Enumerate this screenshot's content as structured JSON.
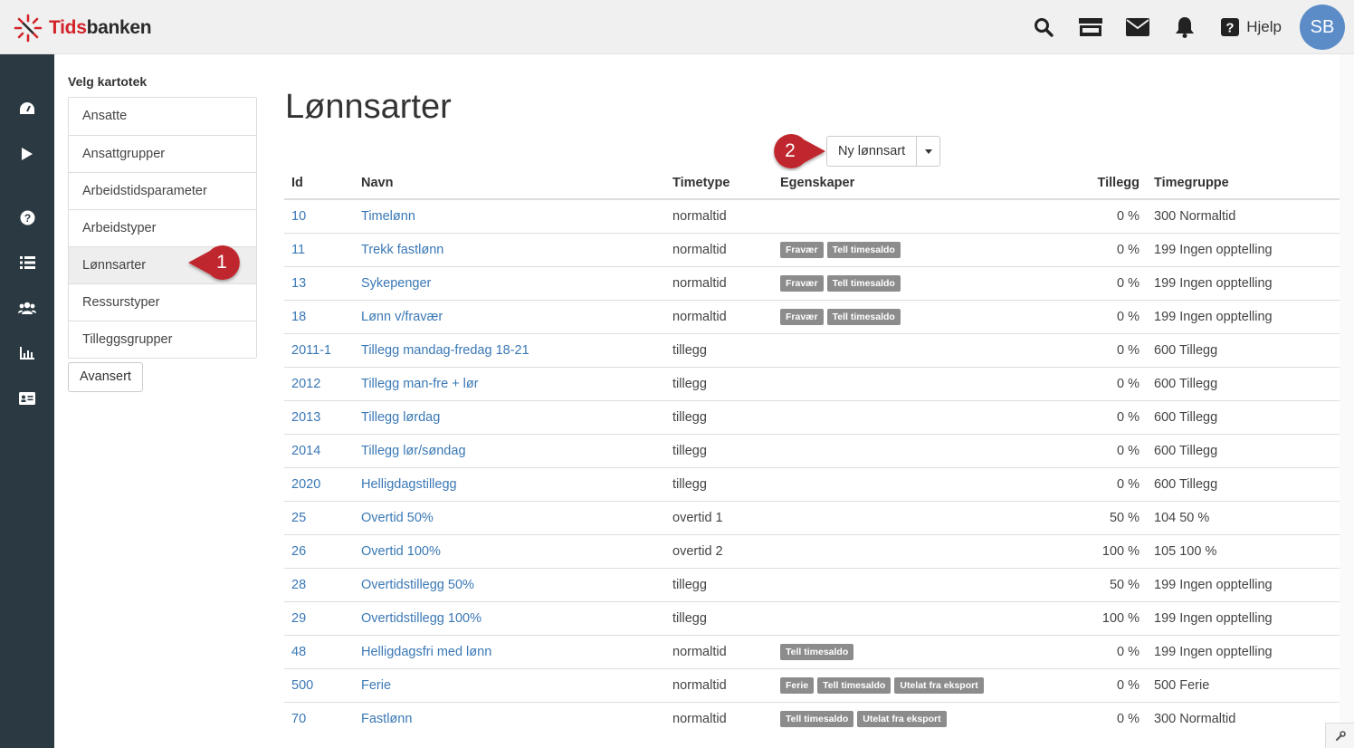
{
  "brand": {
    "name_red": "Tids",
    "name_dark": "banken"
  },
  "topbar": {
    "help_label": "Hjelp",
    "avatar_initials": "SB"
  },
  "kartotek": {
    "title": "Velg kartotek",
    "items": [
      {
        "label": "Ansatte",
        "active": false
      },
      {
        "label": "Ansattgrupper",
        "active": false
      },
      {
        "label": "Arbeidstidsparameter",
        "active": false
      },
      {
        "label": "Arbeidstyper",
        "active": false
      },
      {
        "label": "Lønnsarter",
        "active": true
      },
      {
        "label": "Ressurstyper",
        "active": false
      },
      {
        "label": "Tilleggsgrupper",
        "active": false
      }
    ],
    "advanced_label": "Avansert"
  },
  "main": {
    "title": "Lønnsarter",
    "new_button_label": "Ny lønnsart",
    "callouts": [
      "1",
      "2"
    ],
    "columns": [
      "Id",
      "Navn",
      "Timetype",
      "Egenskaper",
      "Tillegg",
      "Timegruppe"
    ],
    "rows": [
      {
        "id": "10",
        "navn": "Timelønn",
        "timetype": "normaltid",
        "egenskaper": [],
        "tillegg": "0 %",
        "timegruppe": "300 Normaltid"
      },
      {
        "id": "11",
        "navn": "Trekk fastlønn",
        "timetype": "normaltid",
        "egenskaper": [
          "Fravær",
          "Tell timesaldo"
        ],
        "tillegg": "0 %",
        "timegruppe": "199 Ingen opptelling"
      },
      {
        "id": "13",
        "navn": "Sykepenger",
        "timetype": "normaltid",
        "egenskaper": [
          "Fravær",
          "Tell timesaldo"
        ],
        "tillegg": "0 %",
        "timegruppe": "199 Ingen opptelling"
      },
      {
        "id": "18",
        "navn": "Lønn v/fravær",
        "timetype": "normaltid",
        "egenskaper": [
          "Fravær",
          "Tell timesaldo"
        ],
        "tillegg": "0 %",
        "timegruppe": "199 Ingen opptelling"
      },
      {
        "id": "2011-1",
        "navn": "Tillegg mandag-fredag 18-21",
        "timetype": "tillegg",
        "egenskaper": [],
        "tillegg": "0 %",
        "timegruppe": "600 Tillegg"
      },
      {
        "id": "2012",
        "navn": "Tillegg man-fre + lør",
        "timetype": "tillegg",
        "egenskaper": [],
        "tillegg": "0 %",
        "timegruppe": "600 Tillegg"
      },
      {
        "id": "2013",
        "navn": "Tillegg lørdag",
        "timetype": "tillegg",
        "egenskaper": [],
        "tillegg": "0 %",
        "timegruppe": "600 Tillegg"
      },
      {
        "id": "2014",
        "navn": "Tillegg lør/søndag",
        "timetype": "tillegg",
        "egenskaper": [],
        "tillegg": "0 %",
        "timegruppe": "600 Tillegg"
      },
      {
        "id": "2020",
        "navn": "Helligdagstillegg",
        "timetype": "tillegg",
        "egenskaper": [],
        "tillegg": "0 %",
        "timegruppe": "600 Tillegg"
      },
      {
        "id": "25",
        "navn": "Overtid 50%",
        "timetype": "overtid 1",
        "egenskaper": [],
        "tillegg": "50 %",
        "timegruppe": "104 50 %"
      },
      {
        "id": "26",
        "navn": "Overtid 100%",
        "timetype": "overtid 2",
        "egenskaper": [],
        "tillegg": "100 %",
        "timegruppe": "105 100 %"
      },
      {
        "id": "28",
        "navn": "Overtidstillegg 50%",
        "timetype": "tillegg",
        "egenskaper": [],
        "tillegg": "50 %",
        "timegruppe": "199 Ingen opptelling"
      },
      {
        "id": "29",
        "navn": "Overtidstillegg 100%",
        "timetype": "tillegg",
        "egenskaper": [],
        "tillegg": "100 %",
        "timegruppe": "199 Ingen opptelling"
      },
      {
        "id": "48",
        "navn": "Helligdagsfri med lønn",
        "timetype": "normaltid",
        "egenskaper": [
          "Tell timesaldo"
        ],
        "tillegg": "0 %",
        "timegruppe": "199 Ingen opptelling"
      },
      {
        "id": "500",
        "navn": "Ferie",
        "timetype": "normaltid",
        "egenskaper": [
          "Ferie",
          "Tell timesaldo",
          "Utelat fra eksport"
        ],
        "tillegg": "0 %",
        "timegruppe": "500 Ferie"
      },
      {
        "id": "70",
        "navn": "Fastlønn",
        "timetype": "normaltid",
        "egenskaper": [
          "Tell timesaldo",
          "Utelat fra eksport"
        ],
        "tillegg": "0 %",
        "timegruppe": "300 Normaltid"
      }
    ]
  },
  "icons": {
    "top": [
      "search-icon",
      "store-icon",
      "mail-icon",
      "bell-icon",
      "help-icon"
    ],
    "side": [
      "dashboard-icon",
      "play-icon",
      "question-icon",
      "list-icon",
      "users-icon",
      "chart-icon",
      "id-card-icon"
    ]
  },
  "colors": {
    "sidebar": "#2b3a42",
    "link": "#3a78b5",
    "badge": "#8c8c8c",
    "callout": "#c0272d",
    "avatar": "#5b8cc7"
  }
}
